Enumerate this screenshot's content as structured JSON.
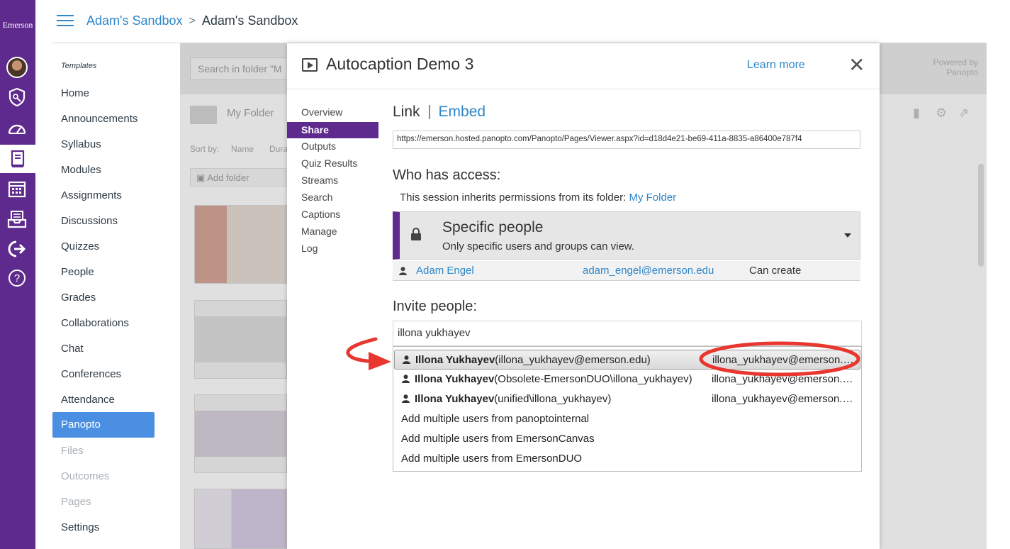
{
  "brand": "Emerson",
  "header": {
    "crumb_course": "Adam's Sandbox",
    "crumb_sep": ">",
    "crumb_page": "Adam's Sandbox"
  },
  "course_nav": {
    "section_label": "Templates",
    "items": [
      "Home",
      "Announcements",
      "Syllabus",
      "Modules",
      "Assignments",
      "Discussions",
      "Quizzes",
      "People",
      "Grades",
      "Collaborations",
      "Chat",
      "Conferences",
      "Attendance",
      "Panopto",
      "Files",
      "Outcomes",
      "Pages",
      "Settings"
    ],
    "active": "Panopto"
  },
  "underlay": {
    "search_placeholder": "Search in folder \"M",
    "powered_line1": "Powered by",
    "powered_line2": "Panopto",
    "folder_name": "My Folder",
    "sort_by": "Sort by:",
    "sort_name": "Name",
    "sort_duration": "Dura",
    "add_folder": "Add folder"
  },
  "modal": {
    "title": "Autocaption Demo 3",
    "learn_more": "Learn more",
    "close_glyph": "✕",
    "nav": [
      "Overview",
      "Share",
      "Outputs",
      "Quiz Results",
      "Streams",
      "Search",
      "Captions",
      "Manage",
      "Log"
    ],
    "nav_active": "Share",
    "tabs": {
      "link": "Link",
      "embed": "Embed"
    },
    "url": "https://emerson.hosted.panopto.com/Panopto/Pages/Viewer.aspx?id=d18d4e21-be69-411a-8835-a86400e787f4",
    "who_has_access": "Who has access:",
    "inherit_text": "This session inherits permissions from its folder:",
    "inherit_folder": "My Folder",
    "access_title": "Specific people",
    "access_desc": "Only specific users and groups can view.",
    "member": {
      "name": "Adam Engel",
      "email": "adam_engel@emerson.edu",
      "role": "Can create"
    },
    "invite_label": "Invite people:",
    "invite_value": "illona yukhayev",
    "suggestions": [
      {
        "name": "Illona Yukhayev",
        "detail": "(illona_yukhayev@emerson.edu)",
        "email": "illona_yukhayev@emerson.edu"
      },
      {
        "name": "Illona Yukhayev",
        "detail": "(Obsolete-EmersonDUO\\illona_yukhayev)",
        "email": "illona_yukhayev@emerson.edu"
      },
      {
        "name": "Illona Yukhayev",
        "detail": "(unified\\illona_yukhayev)",
        "email": "illona_yukhayev@emerson.edu"
      }
    ],
    "bulk_options": [
      "Add multiple users from panoptointernal",
      "Add multiple users from EmersonCanvas",
      "Add multiple users from EmersonDUO"
    ]
  },
  "colors": {
    "nav_purple": "#5e2a8d",
    "link_blue": "#2d87c9",
    "active_blue": "#4a8fe2",
    "annotation_red": "#e8372f"
  }
}
